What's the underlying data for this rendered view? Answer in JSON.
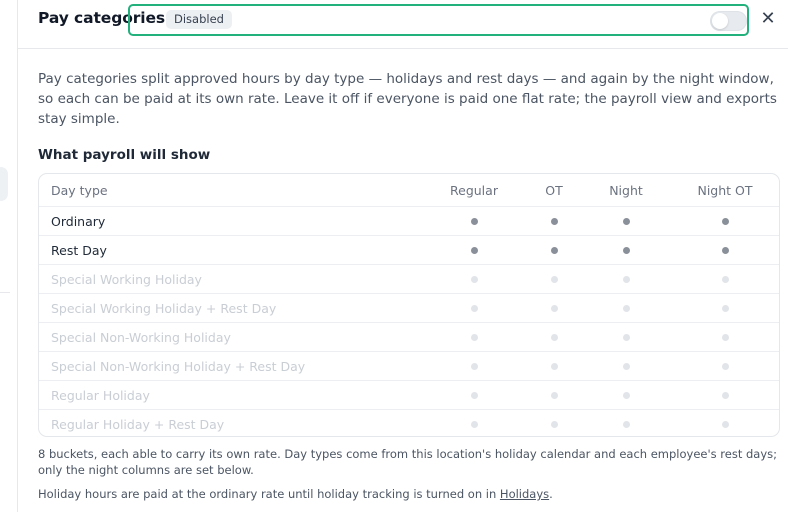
{
  "header": {
    "title": "Pay categories",
    "status_badge": "Disabled",
    "toggle_on": false,
    "close_icon": "close-icon"
  },
  "intro": "Pay categories split approved hours by day type — holidays and rest days — and again by the night window, so each can be paid at its own rate. Leave it off if everyone is paid one flat rate; the payroll view and exports stay simple.",
  "section_title": "What payroll will show",
  "table": {
    "columns": [
      "Day type",
      "Regular",
      "OT",
      "Night",
      "Night OT"
    ],
    "rows": [
      {
        "label": "Ordinary",
        "active": true
      },
      {
        "label": "Rest Day",
        "active": true
      },
      {
        "label": "Special Working Holiday",
        "active": false
      },
      {
        "label": "Special Working Holiday + Rest Day",
        "active": false
      },
      {
        "label": "Special Non-Working Holiday",
        "active": false
      },
      {
        "label": "Special Non-Working Holiday + Rest Day",
        "active": false
      },
      {
        "label": "Regular Holiday",
        "active": false
      },
      {
        "label": "Regular Holiday + Rest Day",
        "active": false
      }
    ]
  },
  "footnote": "8 buckets, each able to carry its own rate. Day types come from this location's holiday calendar and each employee's rest days; only the night columns are set below.",
  "footnote2": {
    "text": "Holiday hours are paid at the ordinary rate until holiday tracking is turned on in ",
    "link": "Holidays",
    "suffix": "."
  },
  "colors": {
    "focus_ring": "#22b07d",
    "dot_active": "#8a9099",
    "dot_muted": "#e1e4e8"
  }
}
